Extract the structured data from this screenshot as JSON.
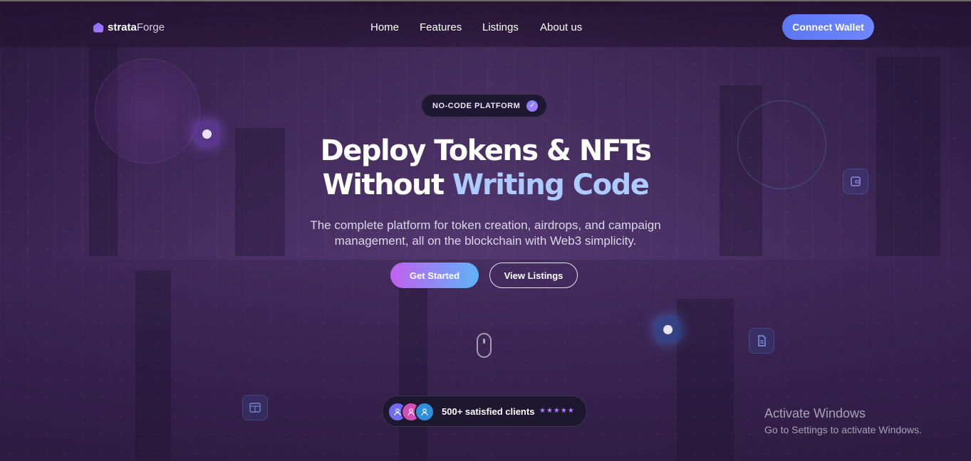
{
  "brand": {
    "name_bold": "strata",
    "name_light": "Forge",
    "logo_icon": "cube-icon"
  },
  "nav": {
    "items": [
      {
        "label": "Home"
      },
      {
        "label": "Features"
      },
      {
        "label": "Listings"
      },
      {
        "label": "About us"
      }
    ]
  },
  "header": {
    "connect_label": "Connect Wallet"
  },
  "hero": {
    "badge_label": "NO-CODE PLATFORM",
    "badge_icon": "check-icon",
    "title_line1": "Deploy Tokens & NFTs",
    "title_line2_plain": "Without ",
    "title_line2_accent": "Writing Code",
    "subtitle_line1": "The complete platform for token creation, airdrops, and campaign",
    "subtitle_line2": "management, all on the blockchain with Web3 simplicity.",
    "primary_cta": "Get Started",
    "secondary_cta": "View Listings",
    "scroll_icon": "mouse-scroll-icon"
  },
  "social_proof": {
    "text": "500+ satisfied clients",
    "stars": "★★★★★",
    "avatar_icons": [
      "user-icon",
      "user-icon",
      "user-icon"
    ]
  },
  "os_overlay": {
    "title": "Activate Windows",
    "subtitle": "Go to Settings to activate Windows."
  },
  "colors": {
    "accent": "#aecbff",
    "connect_button": "#5b78f2",
    "cta_gradient_start": "#c061f0",
    "cta_gradient_end": "#5fb3f5",
    "star": "#b47cff"
  }
}
